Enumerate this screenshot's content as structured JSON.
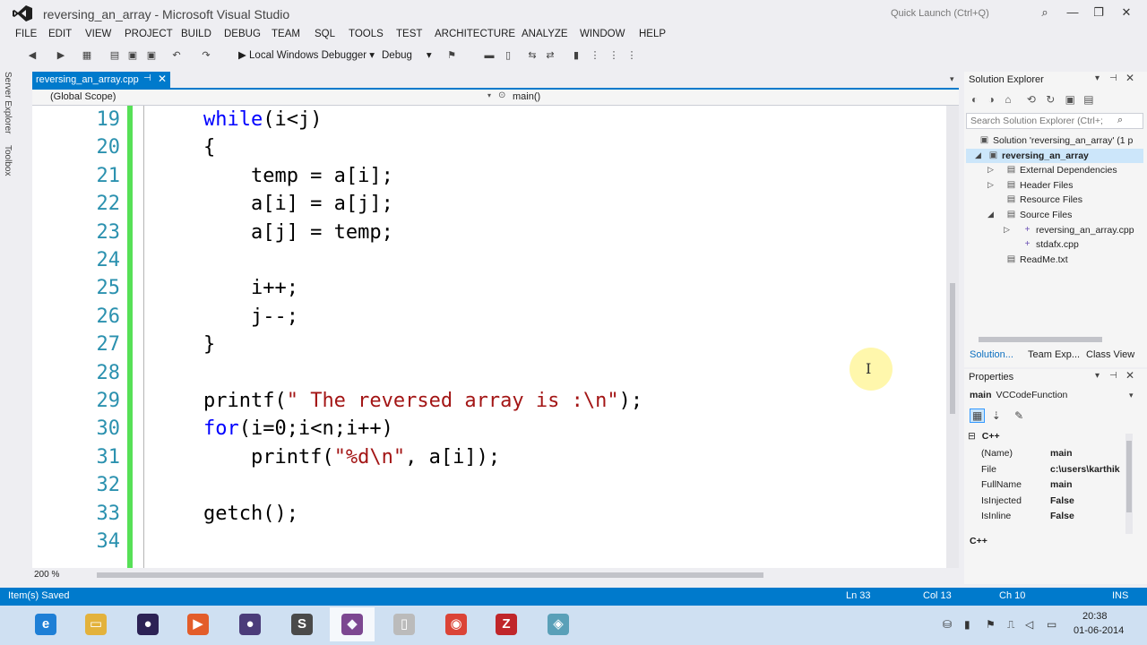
{
  "window": {
    "title": "reversing_an_array - Microsoft Visual Studio",
    "quick_launch": "Quick Launch (Ctrl+Q)",
    "controls": {
      "search": "⌕",
      "minimize": "—",
      "restore": "❐",
      "close": "✕"
    }
  },
  "menu": [
    "FILE",
    "EDIT",
    "VIEW",
    "PROJECT",
    "BUILD",
    "DEBUG",
    "TEAM",
    "SQL",
    "TOOLS",
    "TEST",
    "ARCHITECTURE",
    "ANALYZE",
    "WINDOW",
    "HELP"
  ],
  "toolbar": {
    "debugger": "▶ Local Windows Debugger ▾",
    "configuration": "Debug",
    "config_arrow": "▾"
  },
  "left_tabs": [
    "Server Explorer",
    "Toolbox"
  ],
  "editor": {
    "tab": {
      "name": "reversing_an_array.cpp",
      "pin": "⊣",
      "close": "✕"
    },
    "tab_dropdown": "▾",
    "scope": "(Global Scope)",
    "scope_arrow": "▾",
    "function_icon": "⊙",
    "function": "main()",
    "zoom": "200 %",
    "lines": [
      {
        "num": "19",
        "parts": [
          {
            "t": "    "
          },
          {
            "t": "while",
            "k": "kw"
          },
          {
            "t": "(i<j)"
          }
        ]
      },
      {
        "num": "20",
        "parts": [
          {
            "t": "    {"
          }
        ]
      },
      {
        "num": "21",
        "parts": [
          {
            "t": "        temp = a[i];"
          }
        ]
      },
      {
        "num": "22",
        "parts": [
          {
            "t": "        a[i] = a[j];"
          }
        ]
      },
      {
        "num": "23",
        "parts": [
          {
            "t": "        a[j] = temp;"
          }
        ]
      },
      {
        "num": "24",
        "parts": [
          {
            "t": ""
          }
        ]
      },
      {
        "num": "25",
        "parts": [
          {
            "t": "        i++;"
          }
        ]
      },
      {
        "num": "26",
        "parts": [
          {
            "t": "        j--;"
          }
        ]
      },
      {
        "num": "27",
        "parts": [
          {
            "t": "    }"
          }
        ]
      },
      {
        "num": "28",
        "parts": [
          {
            "t": ""
          }
        ]
      },
      {
        "num": "29",
        "parts": [
          {
            "t": "    printf("
          },
          {
            "t": "\" The reversed array is :\\n\"",
            "k": "str"
          },
          {
            "t": ");"
          }
        ]
      },
      {
        "num": "30",
        "parts": [
          {
            "t": "    "
          },
          {
            "t": "for",
            "k": "kw"
          },
          {
            "t": "(i=0;i<n;i++)"
          }
        ]
      },
      {
        "num": "31",
        "parts": [
          {
            "t": "        printf("
          },
          {
            "t": "\"%d\\n\"",
            "k": "str"
          },
          {
            "t": ", a[i]);"
          }
        ]
      },
      {
        "num": "32",
        "parts": [
          {
            "t": ""
          }
        ]
      },
      {
        "num": "33",
        "parts": [
          {
            "t": "    getch();"
          }
        ]
      },
      {
        "num": "34",
        "parts": [
          {
            "t": ""
          }
        ]
      }
    ]
  },
  "solution_explorer": {
    "title": "Solution Explorer",
    "search_placeholder": "Search Solution Explorer (Ctrl+;",
    "tree": [
      {
        "label": "Solution 'reversing_an_array' (1 p",
        "icon": "▣",
        "arrow": "",
        "bold": false
      },
      {
        "label": "reversing_an_array",
        "icon": "▣",
        "arrow": "◢",
        "bold": true
      },
      {
        "label": "External Dependencies",
        "icon": "▤",
        "arrow": "▷",
        "bold": false
      },
      {
        "label": "Header Files",
        "icon": "▤",
        "arrow": "▷",
        "bold": false
      },
      {
        "label": "Resource Files",
        "icon": "▤",
        "arrow": "",
        "bold": false
      },
      {
        "label": "Source Files",
        "icon": "▤",
        "arrow": "◢",
        "bold": false
      },
      {
        "label": "reversing_an_array.cpp",
        "icon": "+",
        "arrow": "▷",
        "bold": false
      },
      {
        "label": "stdafx.cpp",
        "icon": "+",
        "arrow": "",
        "bold": false
      },
      {
        "label": "ReadMe.txt",
        "icon": "▤",
        "arrow": "",
        "bold": false
      }
    ],
    "bottom_tabs": [
      "Solution...",
      "Team Exp...",
      "Class View"
    ]
  },
  "properties": {
    "title": "Properties",
    "object_name": "main",
    "object_type": "VCCodeFunction",
    "category": "C++",
    "rows": [
      {
        "name": "(Name)",
        "value": "main"
      },
      {
        "name": "File",
        "value": "c:\\users\\karthik"
      },
      {
        "name": "FullName",
        "value": "main"
      },
      {
        "name": "IsInjected",
        "value": "False"
      },
      {
        "name": "IsInline",
        "value": "False"
      }
    ],
    "footer": "C++"
  },
  "status": {
    "message": "Item(s) Saved",
    "line": "Ln 33",
    "col": "Col 13",
    "ch": "Ch 10",
    "mode": "INS"
  },
  "taskbar": {
    "apps": [
      {
        "name": "internet-explorer",
        "glyph": "e",
        "color": "#1e7fd6"
      },
      {
        "name": "file-explorer",
        "glyph": "▭",
        "color": "#e3b23c"
      },
      {
        "name": "eclipse",
        "glyph": "●",
        "color": "#2c2255"
      },
      {
        "name": "media-player",
        "glyph": "▶",
        "color": "#e35d2a"
      },
      {
        "name": "eclipse-2",
        "glyph": "●",
        "color": "#4b3c7a"
      },
      {
        "name": "sublime-text",
        "glyph": "S",
        "color": "#4a4a4a"
      },
      {
        "name": "visual-studio",
        "glyph": "◆",
        "color": "#68217a"
      },
      {
        "name": "notepad",
        "glyph": "▯",
        "color": "#bbbbbb"
      },
      {
        "name": "chrome",
        "glyph": "◉",
        "color": "#db4437"
      },
      {
        "name": "filezilla",
        "glyph": "Z",
        "color": "#c0262a"
      },
      {
        "name": "other-app",
        "glyph": "◈",
        "color": "#5aa0b8"
      }
    ],
    "time": "20:38",
    "date": "01-06-2014"
  }
}
